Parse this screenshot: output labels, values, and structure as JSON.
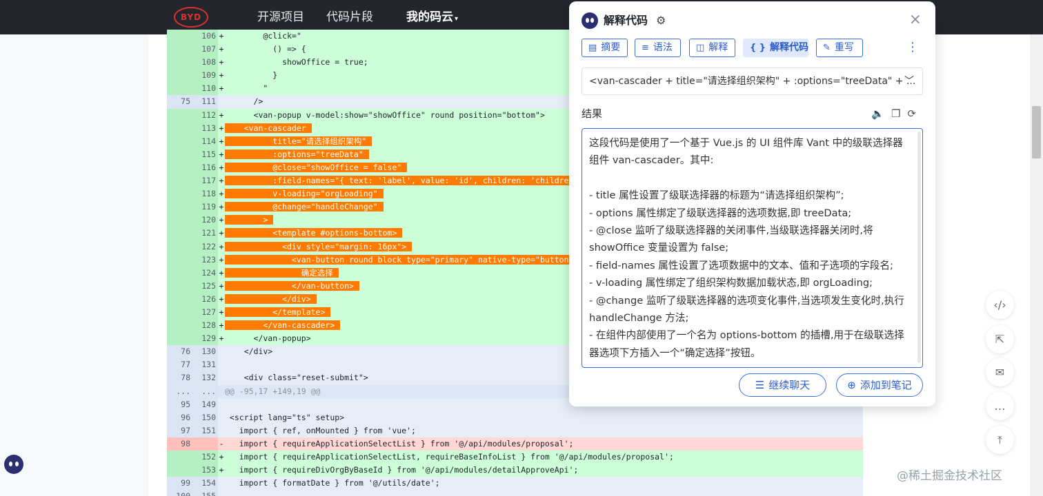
{
  "nav": {
    "logo_text": "BYD",
    "links": [
      "开源项目",
      "代码片段",
      "我的码云"
    ],
    "active_caret": "▾"
  },
  "diff_rows": [
    {
      "t": "add",
      "o": "",
      "n": "106",
      "s": "+",
      "code": "        @click=\""
    },
    {
      "t": "add",
      "o": "",
      "n": "107",
      "s": "+",
      "code": "          () => {"
    },
    {
      "t": "add",
      "o": "",
      "n": "108",
      "s": "+",
      "code": "            showOffice = true;"
    },
    {
      "t": "add",
      "o": "",
      "n": "109",
      "s": "+",
      "code": "          }"
    },
    {
      "t": "add",
      "o": "",
      "n": "110",
      "s": "+",
      "code": "        \""
    },
    {
      "t": "ctx",
      "o": "75",
      "n": "111",
      "s": "",
      "code": "      />"
    },
    {
      "t": "add",
      "o": "",
      "n": "112",
      "s": "+",
      "code": "      <van-popup v-model:show=\"showOffice\" round position=\"bottom\">"
    },
    {
      "t": "add",
      "o": "",
      "n": "113",
      "s": "+",
      "pre": "    ",
      "hl": "    <van-cascader"
    },
    {
      "t": "add",
      "o": "",
      "n": "114",
      "s": "+",
      "pre": "",
      "hl": "          title=\"请选择组织架构\""
    },
    {
      "t": "add",
      "o": "",
      "n": "115",
      "s": "+",
      "pre": "",
      "hl": "          :options=\"treeData\""
    },
    {
      "t": "add",
      "o": "",
      "n": "116",
      "s": "+",
      "pre": "",
      "hl": "          @close=\"showOffice = false\""
    },
    {
      "t": "add",
      "o": "",
      "n": "117",
      "s": "+",
      "pre": "",
      "hl": "          :field-names=\"{ text: 'label', value: 'id', children: 'children' }\""
    },
    {
      "t": "add",
      "o": "",
      "n": "118",
      "s": "+",
      "pre": "",
      "hl": "          v-loading=\"orgLoading\""
    },
    {
      "t": "add",
      "o": "",
      "n": "119",
      "s": "+",
      "pre": "",
      "hl": "          @change=\"handleChange\""
    },
    {
      "t": "add",
      "o": "",
      "n": "120",
      "s": "+",
      "pre": "",
      "hl": "        >"
    },
    {
      "t": "add",
      "o": "",
      "n": "121",
      "s": "+",
      "pre": "",
      "hl": "          <template #options-bottom>"
    },
    {
      "t": "add",
      "o": "",
      "n": "122",
      "s": "+",
      "pre": "",
      "hl": "            <div style=\"margin: 16px\">"
    },
    {
      "t": "add",
      "o": "",
      "n": "123",
      "s": "+",
      "pre": "",
      "hl": "              <van-button round block type=\"primary\" native-type=\"button\">"
    },
    {
      "t": "add",
      "o": "",
      "n": "124",
      "s": "+",
      "pre": "",
      "hl": "                确定选择"
    },
    {
      "t": "add",
      "o": "",
      "n": "125",
      "s": "+",
      "pre": "",
      "hl": "              </van-button>"
    },
    {
      "t": "add",
      "o": "",
      "n": "126",
      "s": "+",
      "pre": "",
      "hl": "            </div>"
    },
    {
      "t": "add",
      "o": "",
      "n": "127",
      "s": "+",
      "pre": "",
      "hl": "          </template>"
    },
    {
      "t": "add",
      "o": "",
      "n": "128",
      "s": "+",
      "pre": "",
      "hl": "        </van-cascader>"
    },
    {
      "t": "add",
      "o": "",
      "n": "129",
      "s": "+",
      "code": "      </van-popup>"
    },
    {
      "t": "ctx",
      "o": "76",
      "n": "130",
      "s": "",
      "code": "    </div>"
    },
    {
      "t": "ctx",
      "o": "77",
      "n": "131",
      "s": "",
      "code": ""
    },
    {
      "t": "ctx",
      "o": "78",
      "n": "132",
      "s": "",
      "code": "    <div class=\"reset-submit\">"
    },
    {
      "t": "hunk",
      "o": "...",
      "n": "...",
      "s": "",
      "code": "@@ -95,17 +149,19 @@"
    },
    {
      "t": "ctx",
      "o": "95",
      "n": "149",
      "s": "",
      "code": ""
    },
    {
      "t": "ctx",
      "o": "96",
      "n": "150",
      "s": "",
      "code": " <script lang=\"ts\" setup>"
    },
    {
      "t": "ctx",
      "o": "97",
      "n": "151",
      "s": "",
      "code": "   import { ref, onMounted } from 'vue';"
    },
    {
      "t": "del",
      "o": "98",
      "n": "",
      "s": "-",
      "code": "   import { requireApplicationSelectList } from '@/api/modules/proposal';"
    },
    {
      "t": "add",
      "o": "",
      "n": "152",
      "s": "+",
      "code": "   import { requireApplicationSelectList, requireBaseInfoList } from '@/api/modules/proposal';"
    },
    {
      "t": "add",
      "o": "",
      "n": "153",
      "s": "+",
      "code": "   import { requireDivOrgByBaseId } from '@/api/modules/detailApproveApi';"
    },
    {
      "t": "ctx",
      "o": "99",
      "n": "154",
      "s": "",
      "code": "   import { formatDate } from '@/utils/date';"
    },
    {
      "t": "ctx",
      "o": "100",
      "n": "155",
      "s": "",
      "code": ""
    }
  ],
  "panel": {
    "title": "解释代码",
    "gear_icon": "gear-icon",
    "close_glyph": "×",
    "tabs": [
      {
        "label": "摘要",
        "icon": "▤"
      },
      {
        "label": "语法",
        "icon": "≡"
      },
      {
        "label": "解释",
        "icon": "◫"
      },
      {
        "label": "解释代码",
        "icon": "{ }",
        "active": true
      },
      {
        "label": "重写",
        "icon": "✎"
      }
    ],
    "more_glyph": "⋮",
    "select_value": "<van-cascader + title=\"请选择组织架构\" + :options=\"treeData\" + ...",
    "select_chevron": "﹀",
    "result_label": "结果",
    "result_icons": "🔈❐⟳",
    "result_paragraphs": [
      "这段代码是使用了一个基于 Vue.js 的 UI 组件库 Vant 中的级联选择器组件 van-cascader。其中:",
      "",
      "- title 属性设置了级联选择器的标题为“请选择组织架构”;",
      "- options 属性绑定了级联选择器的选项数据,即 treeData;",
      "- @close 监听了级联选择器的关闭事件,当级联选择器关闭时,将 showOffice 变量设置为 false;",
      "- field-names 属性设置了选项数据中的文本、值和子选项的字段名;",
      "- v-loading 属性绑定了组织架构数据加载状态,即 orgLoading;",
      "- @change 监听了级联选择器的选项变化事件,当选项发生变化时,执行 handleChange 方法;",
      "- 在组件内部使用了一个名为 options-bottom 的插槽,用于在级联选择器选项下方插入一个“确定选择”按钮。"
    ],
    "continue_chat": "继续聊天",
    "add_note": "添加到笔记"
  },
  "float_buttons": [
    "‹/›",
    "⇱",
    "✉",
    "…",
    "⤒"
  ],
  "watermark": "@稀土掘金技术社区"
}
